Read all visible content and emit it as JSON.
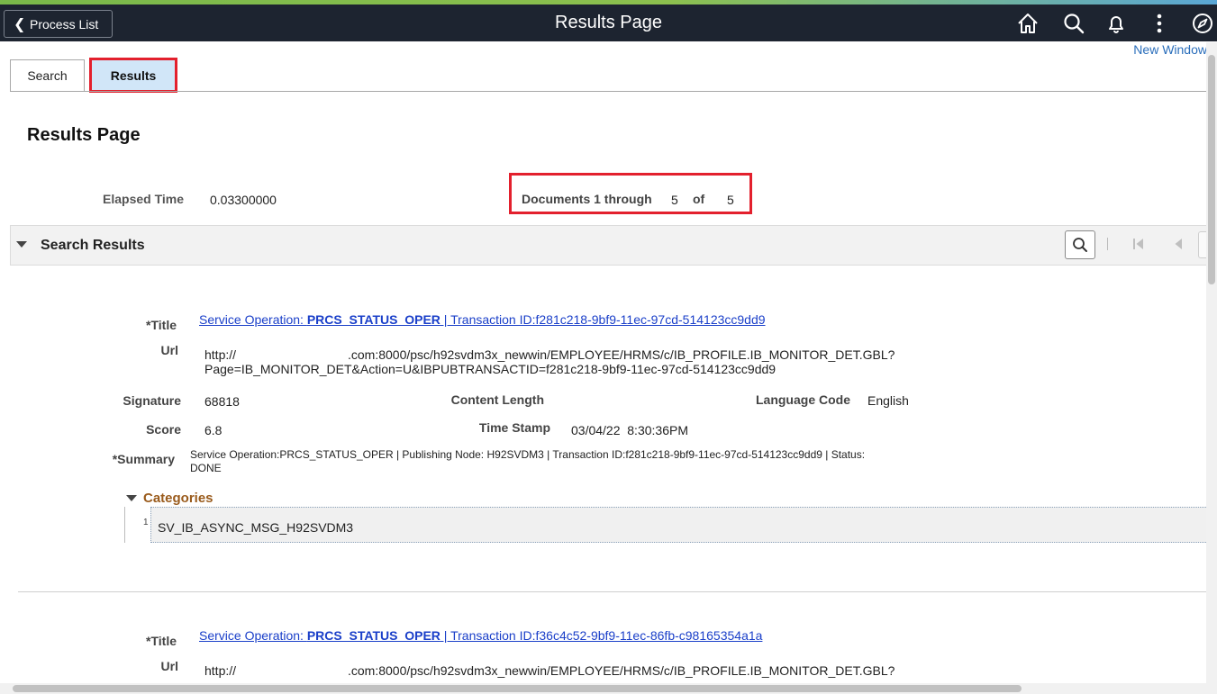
{
  "header": {
    "back_label": "Process List",
    "title": "Results Page",
    "new_window": "New Window",
    "icons": [
      "home-icon",
      "search-icon",
      "bell-icon",
      "kebab-menu-icon",
      "compass-icon"
    ]
  },
  "tabs": [
    {
      "label": "Search",
      "selected": false
    },
    {
      "label": "Results",
      "selected": true
    }
  ],
  "page": {
    "heading": "Results Page",
    "elapsed_label": "Elapsed Time",
    "elapsed_value": "0.03300000",
    "docs_label": "Documents 1 through",
    "docs_from_to": "5",
    "docs_of": "of",
    "docs_total": "5"
  },
  "section": {
    "title": "Search Results"
  },
  "labels": {
    "title": "*Title",
    "url": "Url",
    "signature": "Signature",
    "content_length": "Content Length",
    "language_code": "Language Code",
    "score": "Score",
    "time_stamp": "Time Stamp",
    "summary": "*Summary",
    "categories": "Categories"
  },
  "records": [
    {
      "title_prefix": "Service Operation: ",
      "title_bold": "PRCS_STATUS_OPER",
      "title_suffix": " | Transaction ID:f281c218-9bf9-11ec-97cd-514123cc9dd9",
      "url_line1_a": "http://",
      "url_line1_b": ".com:8000/psc/h92svdm3x_newwin/EMPLOYEE/HRMS/c/IB_PROFILE.IB_MONITOR_DET.GBL?",
      "url_line2": "Page=IB_MONITOR_DET&Action=U&IBPUBTRANSACTID=f281c218-9bf9-11ec-97cd-514123cc9dd9",
      "signature": "68818",
      "content_length": "",
      "language_code": "English",
      "score": "6.8",
      "time_stamp": "03/04/22  8:30:36PM",
      "summary_line1": "Service Operation:PRCS_STATUS_OPER | Publishing Node: H92SVDM3 | Transaction ID:f281c218-9bf9-11ec-97cd-514123cc9dd9 | Status:",
      "summary_line2": "DONE",
      "category_index": "1",
      "category_value": "SV_IB_ASYNC_MSG_H92SVDM3"
    },
    {
      "title_prefix": "Service Operation: ",
      "title_bold": "PRCS_STATUS_OPER",
      "title_suffix": " | Transaction ID:f36c4c52-9bf9-11ec-86fb-c98165354a1a",
      "url_line1_a": "http://",
      "url_line1_b": ".com:8000/psc/h92svdm3x_newwin/EMPLOYEE/HRMS/c/IB_PROFILE.IB_MONITOR_DET.GBL?"
    }
  ]
}
